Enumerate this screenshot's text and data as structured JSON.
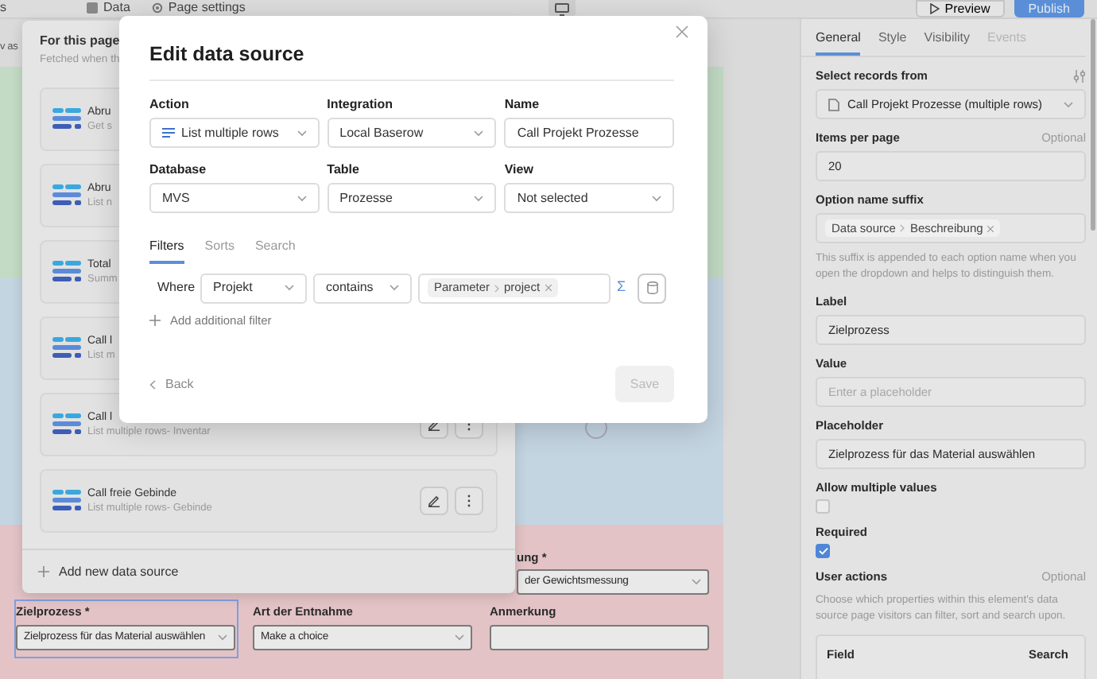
{
  "top_bar": {
    "fragment": "s",
    "tabs": [
      {
        "label": "Data"
      },
      {
        "label": "Page settings"
      }
    ],
    "device_selected": true,
    "preview": "Preview",
    "publish": "Publish"
  },
  "canvas": {
    "fragment": "v as",
    "sections": [
      {
        "color": "#c3dbc4"
      },
      {
        "color": "#c4d5e2"
      },
      {
        "color": "#e3c3c6",
        "fields": [
          {
            "label": "ung *",
            "value": "der Gewichtsmessung",
            "kind": "partial-select",
            "selected": false
          },
          {
            "label": "Zielprozess *",
            "value": "Zielprozess für das Material auswählen",
            "kind": "select",
            "selected": true
          },
          {
            "label": "Art der Entnahme",
            "value": "Make a choice",
            "kind": "select",
            "selected": false
          },
          {
            "label": "Anmerkung",
            "kind": "input",
            "selected": false
          }
        ]
      }
    ]
  },
  "data_sources": {
    "title": "For this page",
    "subtitle": "Fetched when th",
    "items": [
      {
        "name": "Abru",
        "detail": "Get s"
      },
      {
        "name": "Abru",
        "detail": "List n"
      },
      {
        "name": "Total",
        "detail": "Summ"
      },
      {
        "name": "Call l",
        "detail": "List m"
      },
      {
        "name": "Call l",
        "detail": "List multiple rows- Inventar",
        "actions": true
      },
      {
        "name": "Call freie Gebinde",
        "detail": "List multiple rows- Gebinde",
        "actions": true
      }
    ],
    "add": "Add new data source"
  },
  "modal": {
    "title": "Edit data source",
    "fields": [
      {
        "label": "Action",
        "value": "List multiple rows",
        "kind": "select-with-icon"
      },
      {
        "label": "Integration",
        "value": "Local Baserow",
        "kind": "select"
      },
      {
        "label": "Name",
        "value": "Call Projekt Prozesse",
        "kind": "input"
      },
      {
        "label": "Database",
        "value": "MVS",
        "kind": "select"
      },
      {
        "label": "Table",
        "value": "Prozesse",
        "kind": "select"
      },
      {
        "label": "View",
        "value": "Not selected",
        "kind": "select"
      }
    ],
    "tabs": [
      {
        "label": "Filters",
        "selected": true
      },
      {
        "label": "Sorts",
        "selected": false
      },
      {
        "label": "Search",
        "selected": false
      }
    ],
    "filter": {
      "where": "Where",
      "field": "Projekt",
      "operator": "contains",
      "value_path": [
        "Parameter",
        "project"
      ],
      "formula_symbol": "Σ"
    },
    "add_filter": "Add additional filter",
    "back": "Back",
    "save": "Save",
    "save_disabled": true
  },
  "properties": {
    "tabs": [
      {
        "label": "General",
        "selected": true,
        "disabled": false
      },
      {
        "label": "Style",
        "selected": false,
        "disabled": false
      },
      {
        "label": "Visibility",
        "selected": false,
        "disabled": false
      },
      {
        "label": "Events",
        "selected": false,
        "disabled": true
      }
    ],
    "fields": [
      {
        "kind": "select",
        "label": "Select records from",
        "value": "Call Projekt Prozesse (multiple rows)"
      },
      {
        "kind": "input",
        "label": "Items per page",
        "hint": "Optional",
        "value": "20"
      },
      {
        "kind": "path",
        "label": "Option name suffix",
        "path": [
          "Data source",
          "Beschreibung"
        ],
        "help": "This suffix is appended to each option name when you open the dropdown and helps to distinguish them."
      },
      {
        "kind": "input",
        "label": "Label",
        "value": "Zielprozess"
      },
      {
        "kind": "input",
        "label": "Value",
        "placeholder": "Enter a placeholder"
      },
      {
        "kind": "input",
        "label": "Placeholder",
        "value": "Zielprozess für das Material auswählen"
      },
      {
        "kind": "checkbox",
        "label": "Allow multiple values",
        "checked": false
      },
      {
        "kind": "checkbox",
        "label": "Required",
        "checked": true
      },
      {
        "kind": "table",
        "label": "User actions",
        "hint": "Optional",
        "help": "Choose which properties within this element's data source page visitors can filter, sort and search upon.",
        "columns": [
          "Field",
          "Search"
        ]
      }
    ]
  }
}
